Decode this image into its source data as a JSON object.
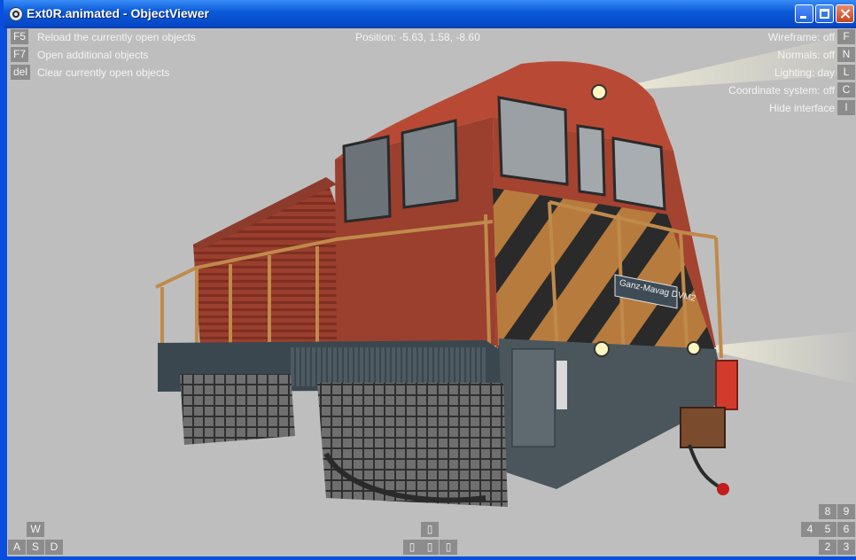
{
  "window": {
    "title": "Ext0R.animated - ObjectViewer"
  },
  "hud": {
    "left": [
      {
        "key": "F5",
        "label": "Reload the currently open objects"
      },
      {
        "key": "F7",
        "label": "Open additional objects"
      },
      {
        "key": "del",
        "label": "Clear currently open objects"
      }
    ],
    "position": "Position: -5.63, 1.58, -8.60",
    "right": [
      {
        "label": "Wireframe: off",
        "key": "F"
      },
      {
        "label": "Normals: off",
        "key": "N"
      },
      {
        "label": "Lighting: day",
        "key": "L"
      },
      {
        "label": "Coordinate system: off",
        "key": "C"
      },
      {
        "label": "Hide interface",
        "key": "I"
      }
    ]
  },
  "nav": {
    "wasd": {
      "w": "W",
      "a": "A",
      "s": "S",
      "d": "D"
    },
    "arrows": {
      "up": "▯",
      "left": "▯",
      "down": "▯",
      "right": "▯"
    },
    "numpad": {
      "n8": "8",
      "n9": "9",
      "n4": "4",
      "n5": "5",
      "n6": "6",
      "n2": "2",
      "n3": "3"
    }
  },
  "model": {
    "nameplate": "Ganz-Mavag DVM2"
  }
}
